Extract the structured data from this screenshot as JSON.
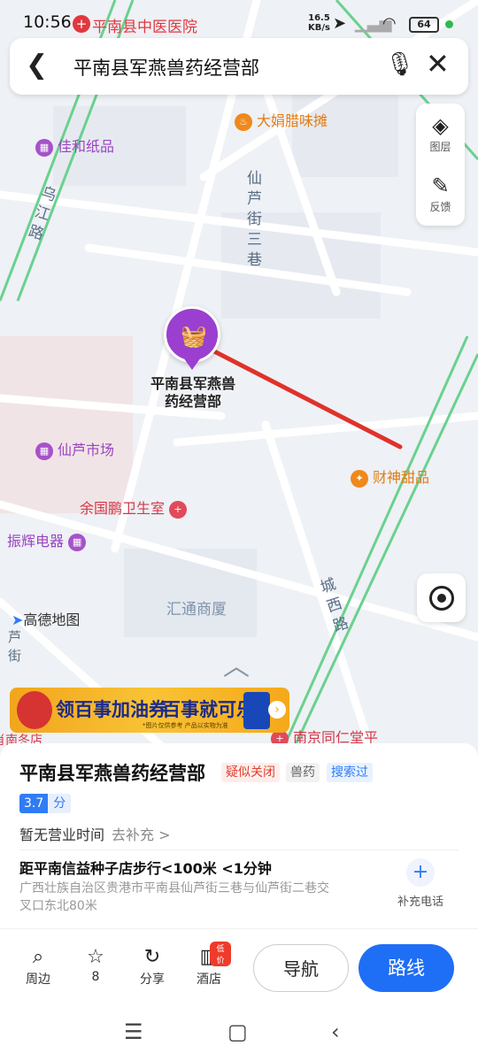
{
  "status_bar": {
    "time": "10:56",
    "notification_app": "平南县中医医院",
    "net_speed_value": "16.5",
    "net_speed_unit": "KB/s",
    "battery": "64"
  },
  "search_bar": {
    "query": "平南县军燕兽药经营部"
  },
  "map": {
    "pois": [
      {
        "name": "大娟腊味摊",
        "icon": "food-icon",
        "color": "#f0891c"
      },
      {
        "name": "佳和纸品",
        "icon": "shop-icon",
        "color": "#a652c9"
      },
      {
        "name": "仙芦市场",
        "icon": "market-icon",
        "color": "#a652c9"
      },
      {
        "name": "财神甜品",
        "icon": "dessert-icon",
        "color": "#f0891c"
      },
      {
        "name": "余国鹏卫生室",
        "icon": "clinic-icon",
        "color": "#e04a5a"
      },
      {
        "name": "振辉电器",
        "icon": "appliance-icon",
        "color": "#a652c9"
      },
      {
        "name": "汇通商厦",
        "icon": "",
        "color": "#8aa0b8"
      },
      {
        "name": "南京同仁堂平",
        "icon": "pharmacy-icon",
        "color": "#e04a5a"
      },
      {
        "name": "肖南冬店",
        "icon": "",
        "color": "#e04a5a"
      }
    ],
    "streets": [
      "乌江路",
      "仙芦街三巷",
      "城西路",
      "芦街"
    ],
    "selected_pin_label": "平南县军燕兽药经营部",
    "layers_label": "图层",
    "feedback_label": "反馈",
    "brand": "高德地图"
  },
  "banner": {
    "text_left": "领百事加油券",
    "text_right": "百事就可乐",
    "fine_print": "*图片仅供参考  产品以实物为准"
  },
  "place": {
    "name": "平南县军燕兽药经营部",
    "tags": [
      {
        "label": "疑似关闭",
        "color": "#e0412f",
        "bg": "#fdeeec"
      },
      {
        "label": "兽药",
        "color": "#666666",
        "bg": "#f2f2f2"
      },
      {
        "label": "搜索过",
        "color": "#2f7cf5",
        "bg": "#e9f1fe"
      }
    ],
    "score": "3.7",
    "score_unit": "分",
    "hours": "暂无营业时间",
    "hours_add": "去补充 >",
    "distance": "距平南信益种子店步行<100米 <1分钟",
    "address": "广西壮族自治区贵港市平南县仙芦街三巷与仙芦街二巷交叉口东北80米",
    "add_phone": "补充电话"
  },
  "actions": {
    "nearby": "周边",
    "favorite_count": "8",
    "share": "分享",
    "hotel": "酒店",
    "hotel_badge": "低价",
    "navigate": "导航",
    "route": "路线"
  }
}
